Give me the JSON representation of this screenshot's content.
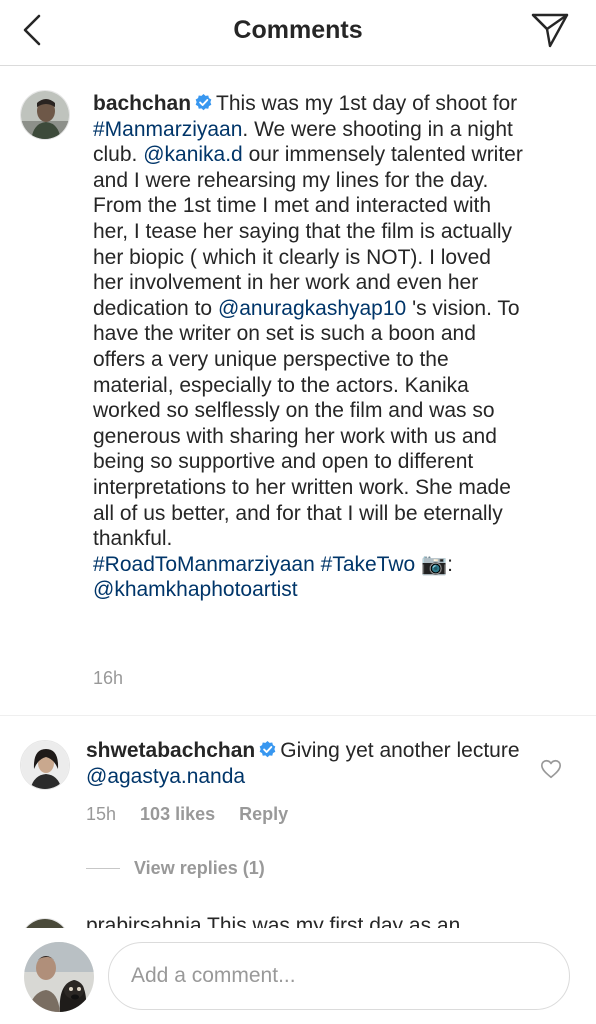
{
  "header": {
    "title": "Comments",
    "back_icon": "chevron-left-icon",
    "share_icon": "paper-plane-icon"
  },
  "post_caption": {
    "username": "bachchan",
    "verified": true,
    "segments": [
      {
        "type": "text",
        "value": "This was my 1st day of shoot for "
      },
      {
        "type": "tag",
        "value": "#Manmarziyaan"
      },
      {
        "type": "text",
        "value": ". We were shooting in a night club. "
      },
      {
        "type": "mention",
        "value": "@kanika.d"
      },
      {
        "type": "text",
        "value": " our immensely talented writer and I were rehearsing my lines for the day."
      },
      {
        "type": "break"
      },
      {
        "type": "text",
        "value": "From the 1st time I met and interacted with her, I tease her saying that the film is actually her biopic ( which it clearly is NOT). I loved her involvement in her work and even her dedication to "
      },
      {
        "type": "mention",
        "value": "@anuragkashyap10"
      },
      {
        "type": "text",
        "value": " 's vision. To have the writer on set is such a boon and offers a very unique perspective to the material, especially to the actors. Kanika worked so selflessly on the film and was so generous with sharing her work with us and being so supportive and open to different interpretations to her written work. She made all of us better, and for that I will be eternally thankful."
      },
      {
        "type": "break"
      },
      {
        "type": "tag",
        "value": "#RoadToManmarziyaan"
      },
      {
        "type": "text",
        "value": " "
      },
      {
        "type": "tag",
        "value": "#TakeTwo"
      },
      {
        "type": "text",
        "value": " 📷: "
      },
      {
        "type": "mention",
        "value": "@khamkhaphotoartist"
      }
    ],
    "time": "16h"
  },
  "comments": [
    {
      "username": "shwetabachchan",
      "verified": true,
      "text": "Giving yet another lecture ",
      "mention": "@agastya.nanda",
      "time": "15h",
      "likes": "103 likes",
      "reply_label": "Reply",
      "like_icon": "heart-outline-icon"
    }
  ],
  "view_replies": "View replies (1)",
  "partial_comment": "prabirsahnia This was my first day as an",
  "composer": {
    "placeholder": "Add a comment..."
  },
  "colors": {
    "link": "#003569",
    "verified": "#3897f0",
    "secondary_text": "#999999"
  }
}
